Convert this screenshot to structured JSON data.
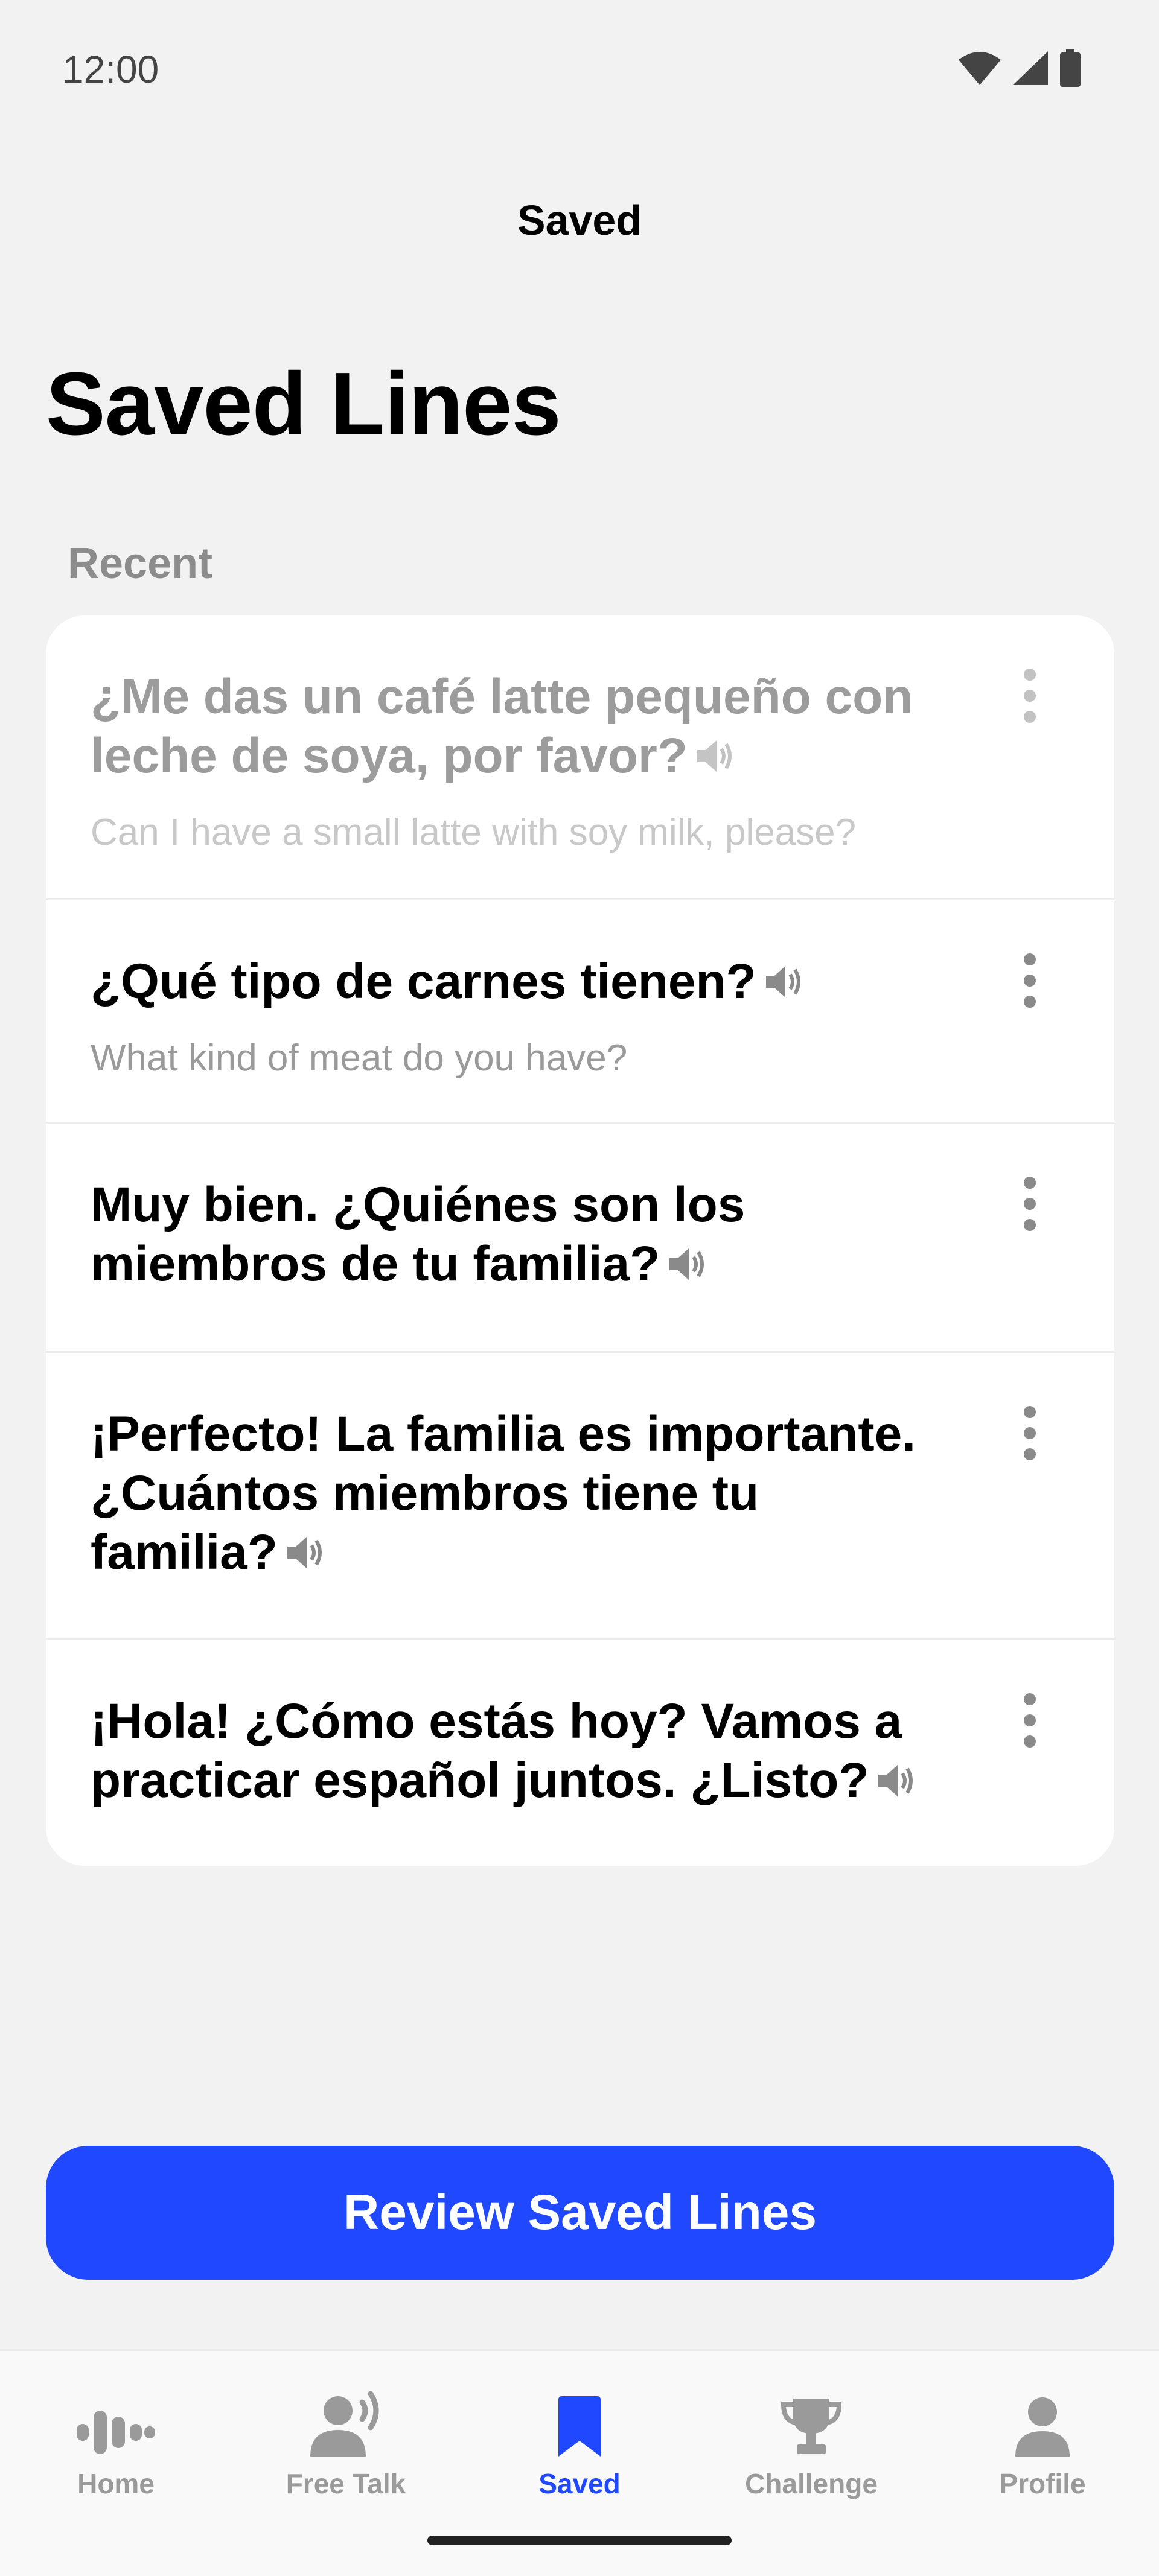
{
  "status_bar": {
    "time": "12:00"
  },
  "header": {
    "title": "Saved"
  },
  "page": {
    "title": "Saved Lines",
    "section_label": "Recent"
  },
  "saved_lines": [
    {
      "text": "¿Me das un café latte pequeño con leche de soya, por favor?",
      "translation": "Can I have a small latte with soy milk, please?"
    },
    {
      "text": "¿Qué tipo de carnes tienen?",
      "translation": "What kind of meat do you have?"
    },
    {
      "text": "Muy bien. ¿Quiénes son los miembros de tu familia?"
    },
    {
      "text": "¡Perfecto! La familia es importante. ¿Cuántos miembros tiene tu familia?"
    },
    {
      "text": "¡Hola! ¿Cómo estás hoy? Vamos a practicar español juntos. ¿Listo?"
    }
  ],
  "primary_action": {
    "label": "Review Saved Lines"
  },
  "tabs": [
    {
      "label": "Home",
      "icon": "waveform-icon"
    },
    {
      "label": "Free Talk",
      "icon": "speaking-person-icon"
    },
    {
      "label": "Saved",
      "icon": "bookmark-icon",
      "active": true
    },
    {
      "label": "Challenge",
      "icon": "trophy-icon"
    },
    {
      "label": "Profile",
      "icon": "person-icon"
    }
  ],
  "colors": {
    "accent": "#1f48ff",
    "background": "#f2f2f2",
    "card": "#ffffff",
    "muted_text": "#9a9a9a"
  }
}
